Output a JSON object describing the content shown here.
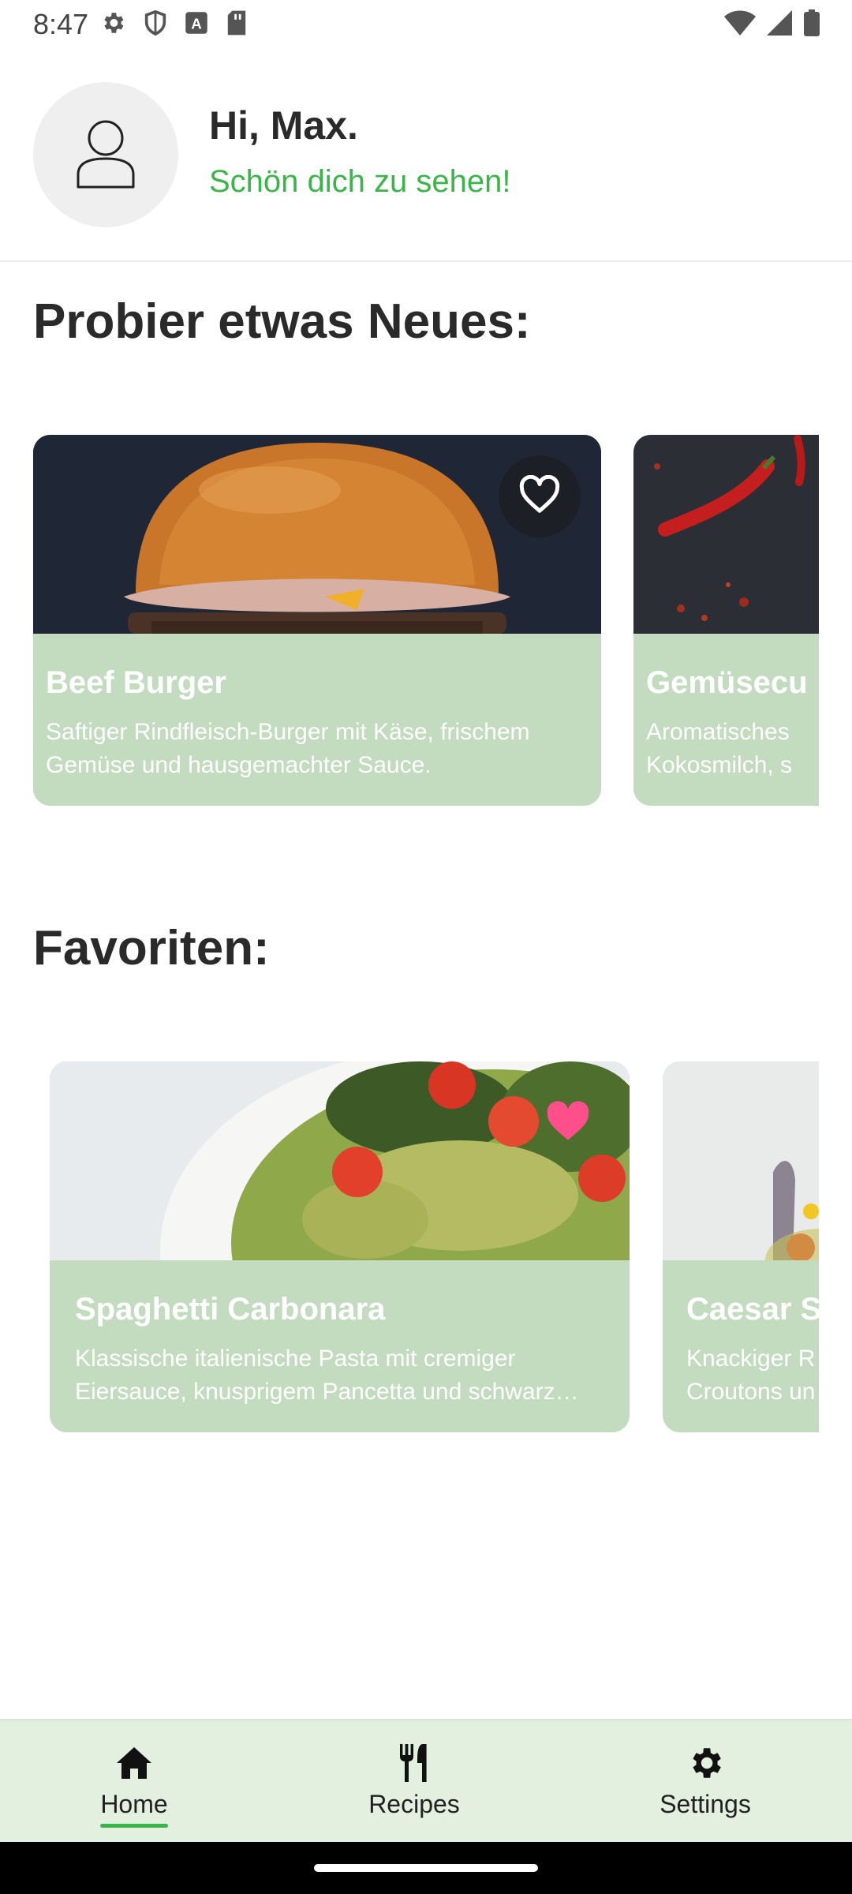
{
  "status_bar": {
    "time": "8:47"
  },
  "header": {
    "greeting": "Hi, Max.",
    "subtitle": "Schön dich zu sehen!"
  },
  "sections": {
    "new_title": "Probier etwas Neues:",
    "favorites_title": "Favoriten:"
  },
  "new_recipes": [
    {
      "title": "Beef Burger",
      "description": "Saftiger Rindfleisch-Burger mit Käse, frischem Gemüse und hausgemachter Sauce.",
      "favorited": false,
      "image": "burger-photo"
    },
    {
      "title": "Gemüsecu",
      "description": "Aromatisches Kokosmilch, s",
      "image": "chili-photo"
    }
  ],
  "favorite_recipes": [
    {
      "title": "Spaghetti Carbonara",
      "description": "Klassische italienische Pasta mit cremiger Eiersauce, knusprigem Pancetta und schwarz…",
      "favorited": true,
      "image": "pasta-salad-photo"
    },
    {
      "title": "Caesar S",
      "description": "Knackiger R Croutons un",
      "image": "salad-photo"
    }
  ],
  "bottom_nav": {
    "items": [
      {
        "label": "Home",
        "icon": "home-icon",
        "active": true
      },
      {
        "label": "Recipes",
        "icon": "fork-knife-icon",
        "active": false
      },
      {
        "label": "Settings",
        "icon": "gear-icon",
        "active": false
      }
    ]
  },
  "colors": {
    "accent": "#3bb54a",
    "card_body": "#c3dbbf",
    "nav_background": "#e3efdf",
    "favorite_heart": "#ff4f8b"
  }
}
